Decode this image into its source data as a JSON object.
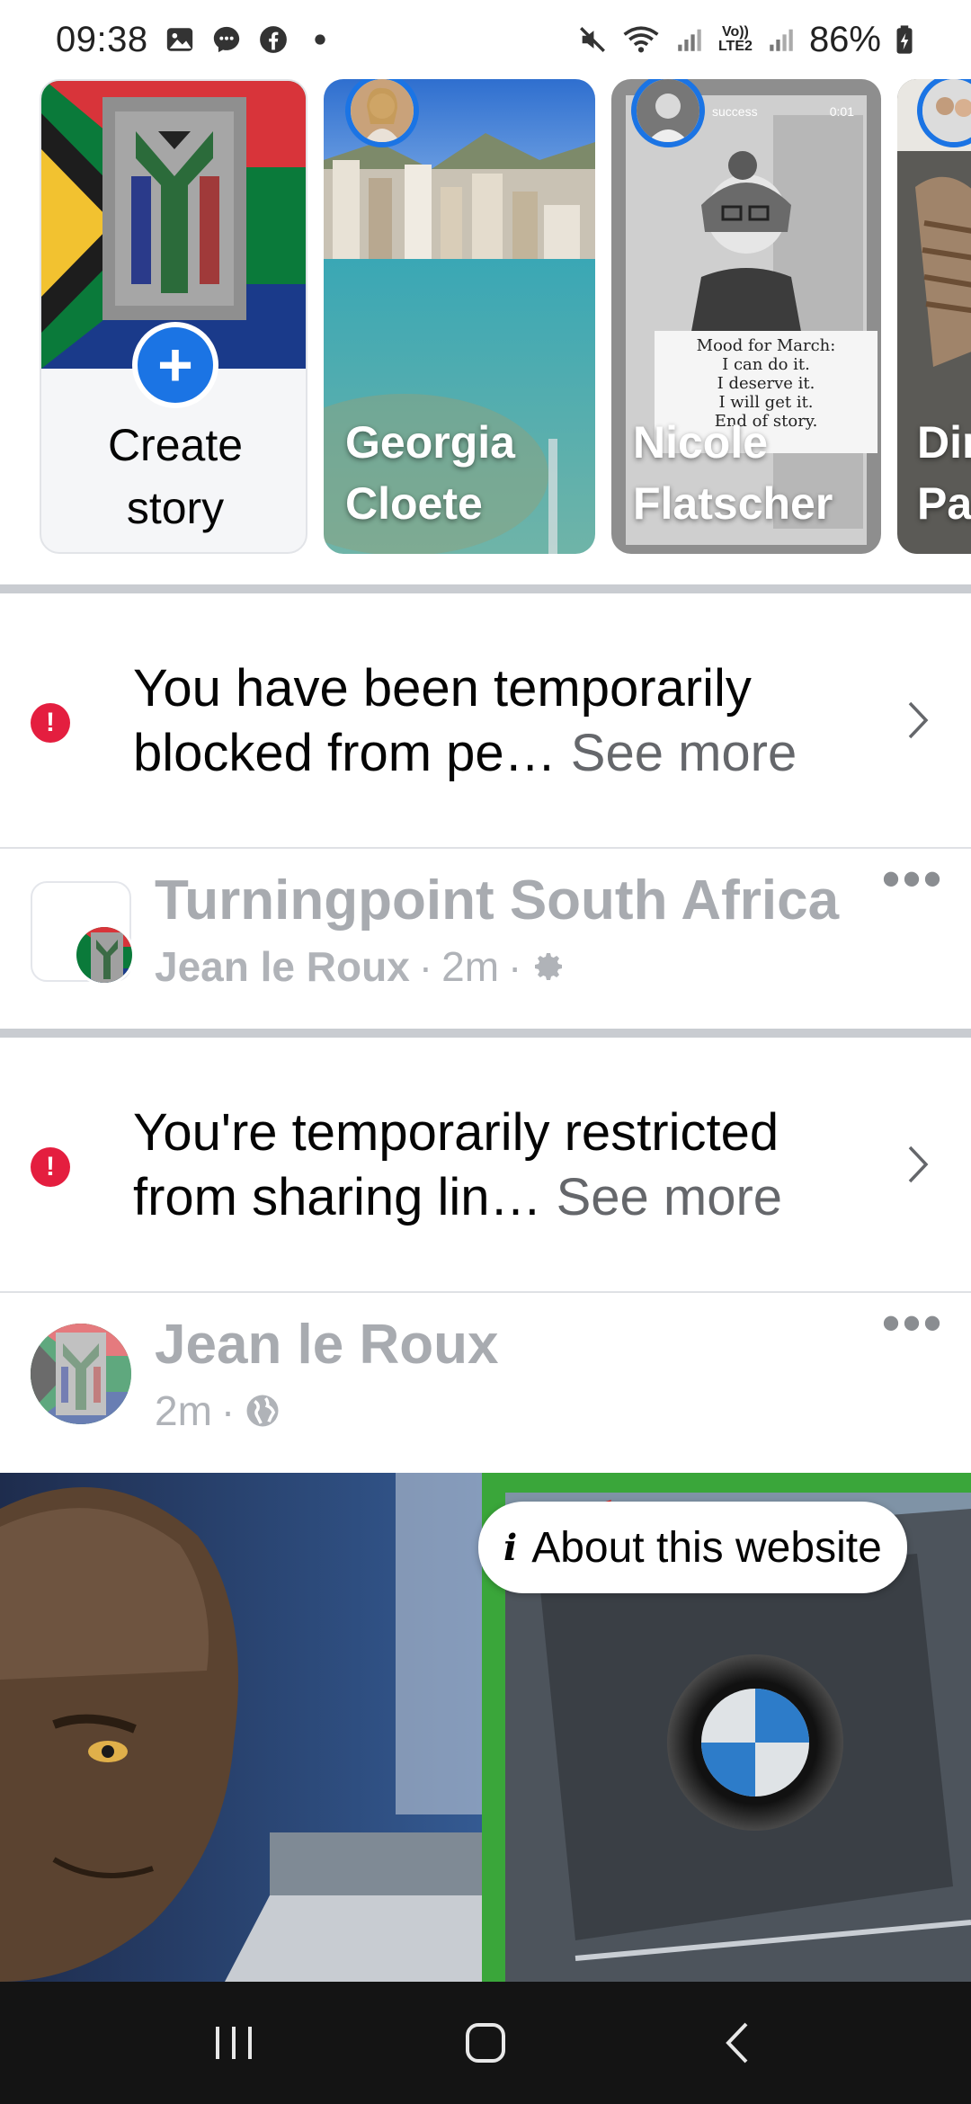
{
  "status_bar": {
    "time": "09:38",
    "battery": "86%",
    "network_label": "Vo)) LTE2",
    "icons": [
      "gallery-icon",
      "messenger-icon",
      "facebook-icon",
      "dot-icon",
      "mute-icon",
      "wifi-icon",
      "signal-icon",
      "signal-icon",
      "battery-icon"
    ]
  },
  "stories": {
    "create": {
      "label_line1": "Create",
      "label_line2": "story"
    },
    "items": [
      {
        "name_line1": "Georgia",
        "name_line2": "Cloete"
      },
      {
        "name_line1": "Nicole",
        "name_line2": "Flatscher",
        "overlay_title": "Mood for March:",
        "overlay_lines": [
          "I can do it.",
          "I deserve it.",
          "I will get it.",
          "End of story."
        ],
        "overlay_small": "success",
        "overlay_time": "0:01"
      },
      {
        "name_line1": "Dir",
        "name_line2": "Pa"
      }
    ]
  },
  "notices": [
    {
      "text": "You have been temporarily blocked from pe…",
      "see_more": "See more"
    },
    {
      "text": "You're temporarily restricted from sharing lin…",
      "see_more": "See more"
    }
  ],
  "group_post": {
    "group_name": "Turningpoint South Africa",
    "author": "Jean le Roux",
    "time": "2m",
    "separator": "·"
  },
  "user_post": {
    "author": "Jean le Roux",
    "time": "2m",
    "separator": "·",
    "about_label": "About this website",
    "about_icon": "i"
  },
  "colors": {
    "accent_blue": "#1b74e4",
    "alert_red": "#e41e3f",
    "muted_text": "#a8abb0",
    "nav_bg": "#141414"
  }
}
